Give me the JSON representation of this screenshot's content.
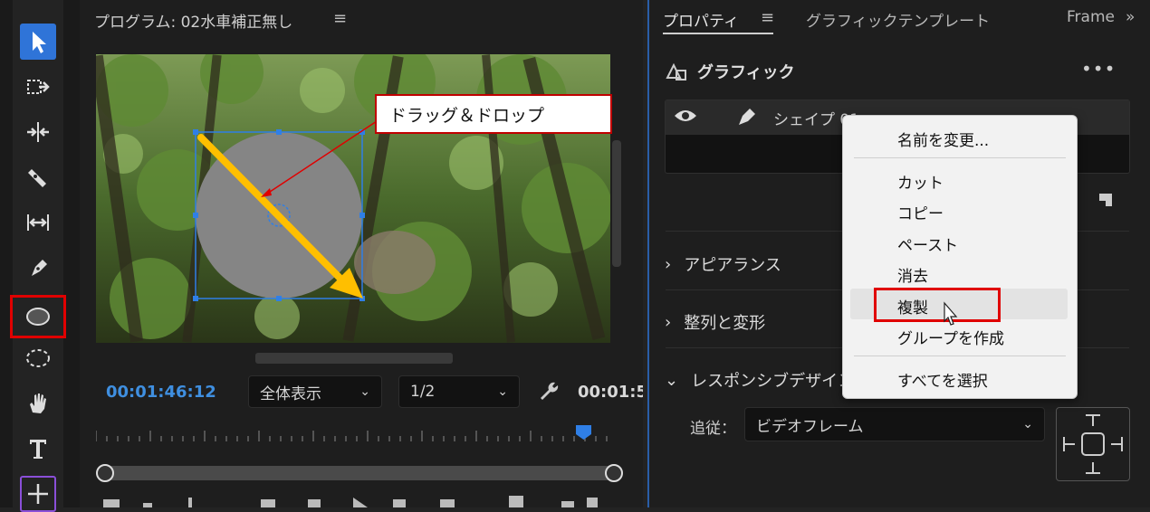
{
  "program_monitor": {
    "title": "プログラム: 02水車補正無し",
    "menu_icon": "hamburger-icon",
    "timecode_current": "00:01:46:12",
    "timecode_duration": "00:01:5",
    "zoom_select": "全体表示",
    "resolution_select": "1/2",
    "callout_text": "ドラッグ＆ドロップ"
  },
  "properties_panel": {
    "tabs": [
      "プロパティ",
      "グラフィックテンプレート",
      "Frame"
    ],
    "section_title": "グラフィック",
    "layer_name": "シェイプ 01",
    "sections": [
      "アピアランス",
      "整列と変形",
      "レスポンシブデザイン"
    ],
    "follow_label": "追従：",
    "follow_value": "ビデオフレーム"
  },
  "context_menu": {
    "items": [
      "名前を変更...",
      "カット",
      "コピー",
      "ペースト",
      "消去",
      "複製",
      "グループを作成",
      "すべてを選択"
    ],
    "highlighted_item": "複製"
  },
  "colors": {
    "accent_blue": "#2a5ea8",
    "highlight_red": "#e00000",
    "arrow_yellow": "#ffbf00",
    "timecode_blue": "#3f8fe0"
  }
}
